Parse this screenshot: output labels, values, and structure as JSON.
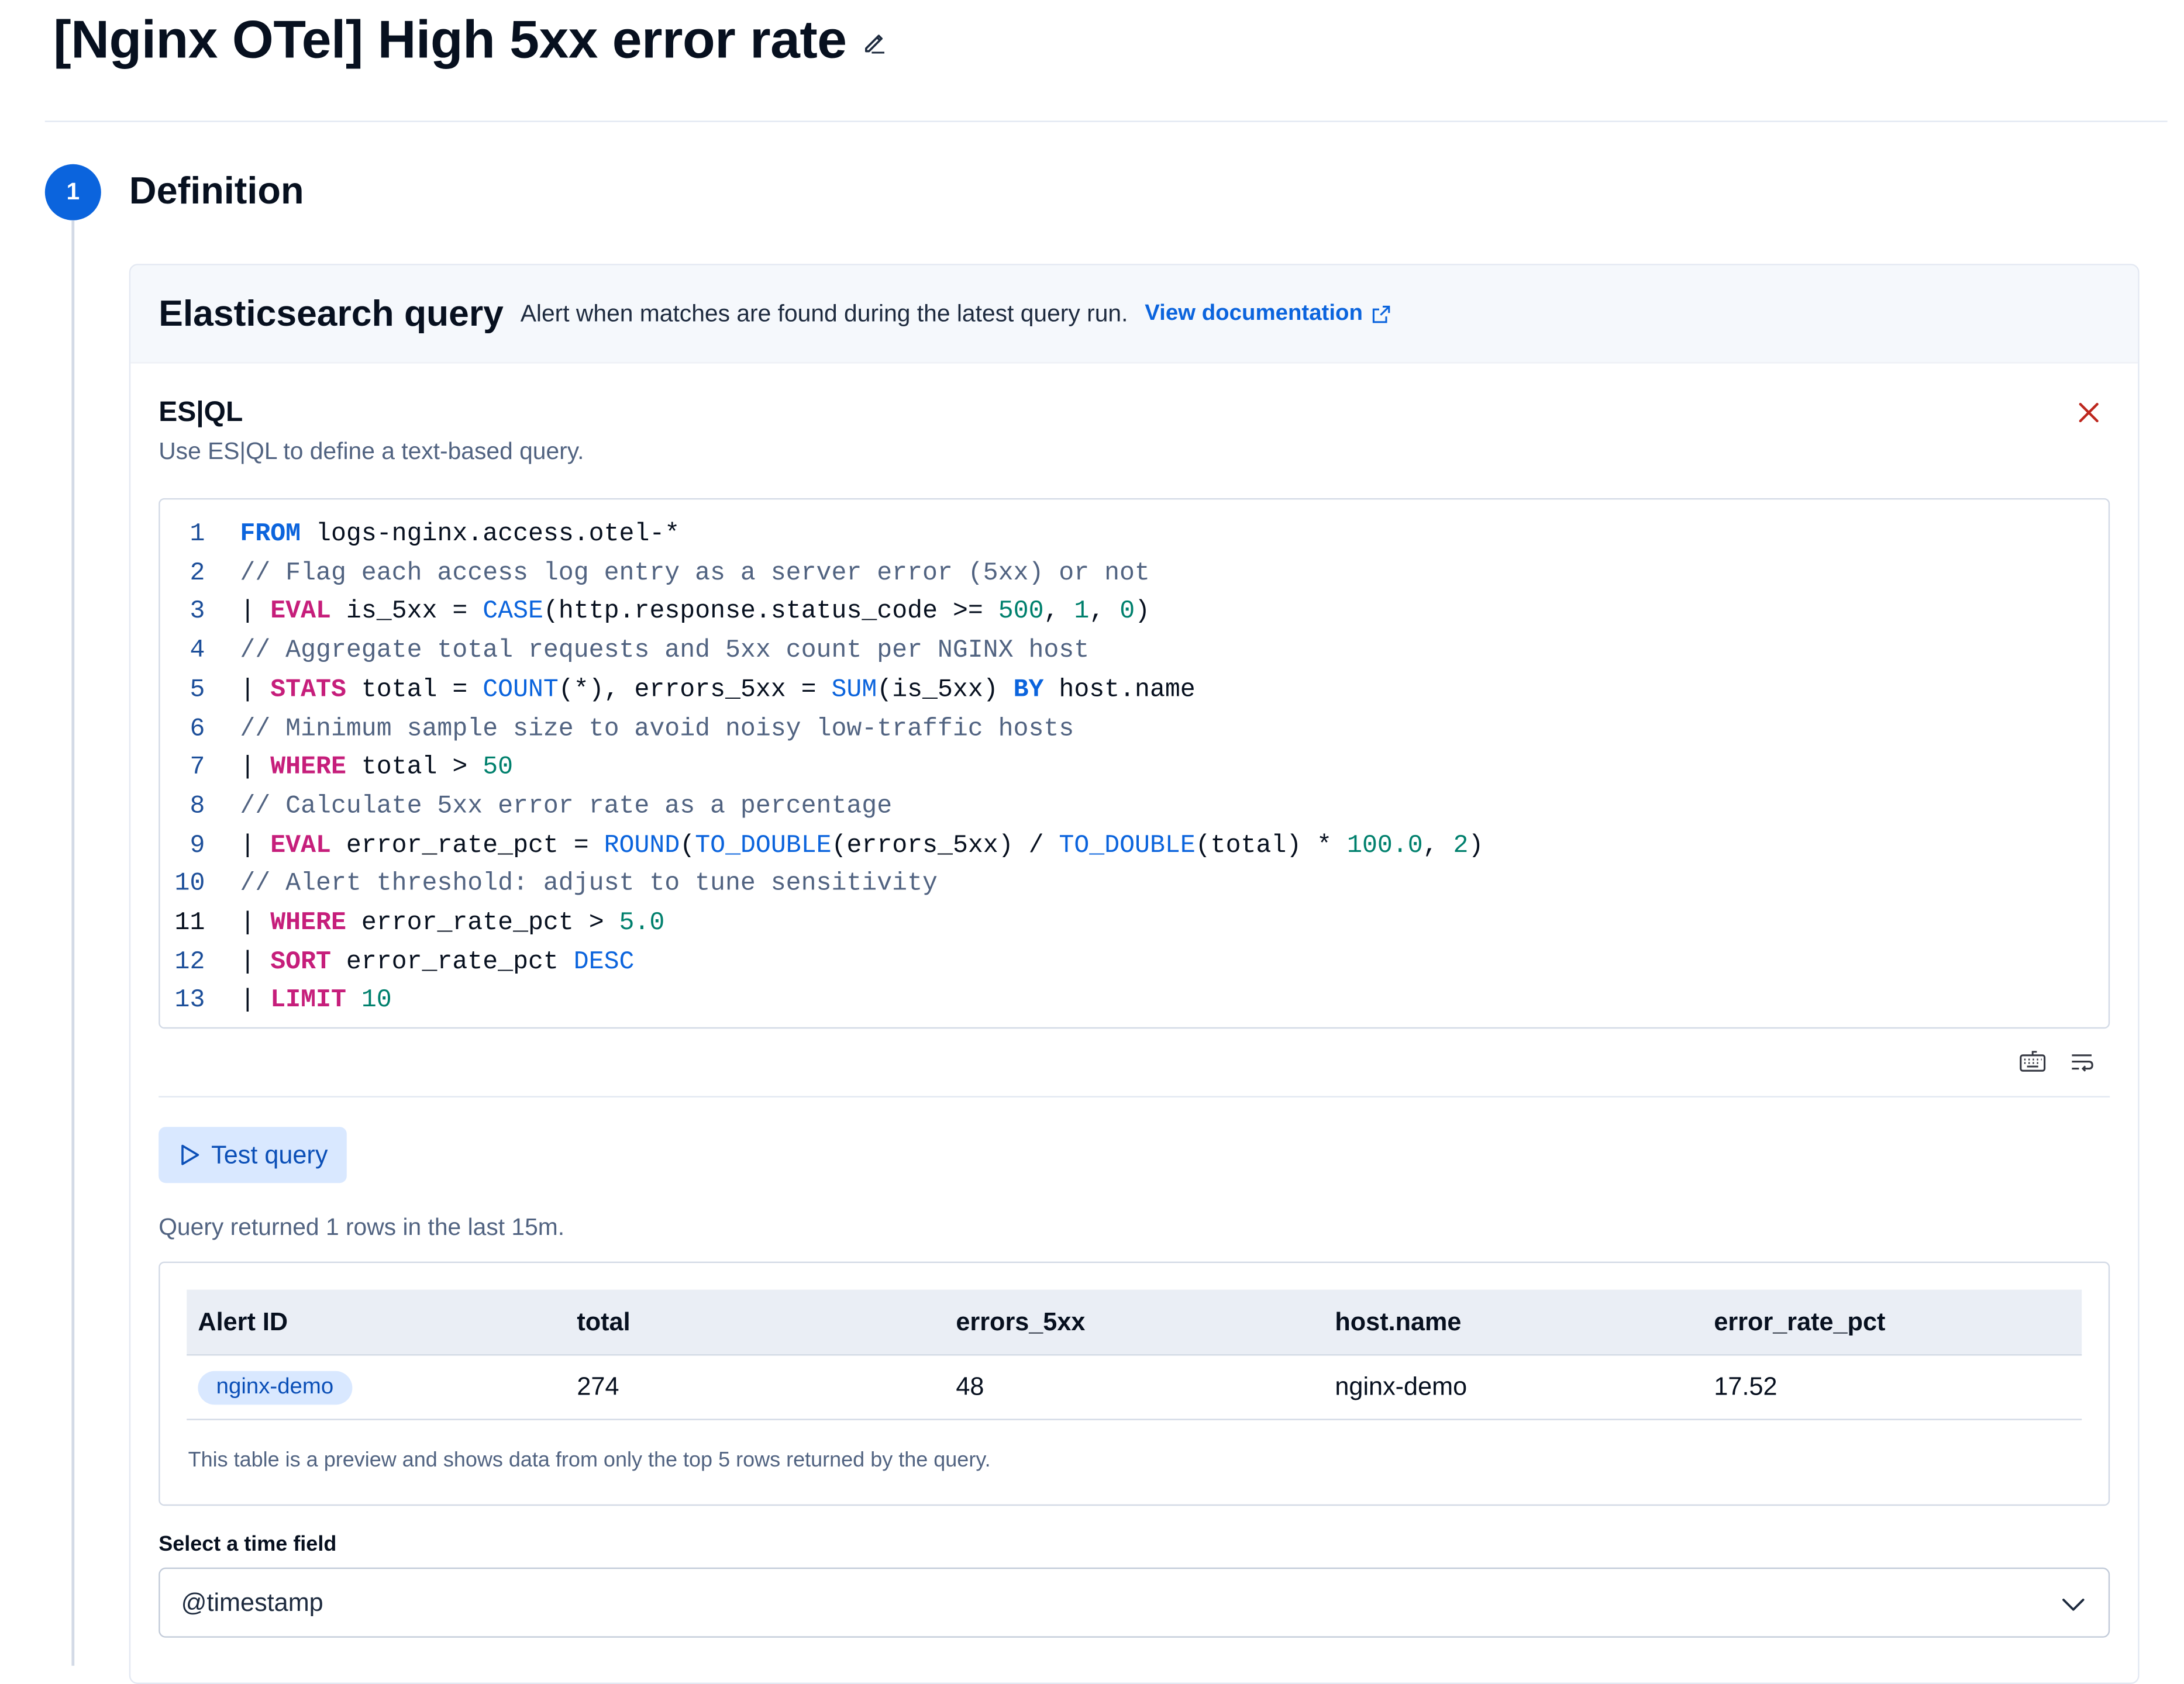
{
  "page": {
    "title": "[Nginx OTel] High 5xx error rate"
  },
  "step": {
    "number": "1",
    "title": "Definition"
  },
  "rule_type": {
    "title": "Elasticsearch query",
    "description": "Alert when matches are found during the latest query run.",
    "doc_link": "View documentation"
  },
  "esql": {
    "title": "ES|QL",
    "description": "Use ES|QL to define a text-based query."
  },
  "editor": {
    "active_line": 11,
    "lines": [
      [
        [
          "kw",
          "FROM"
        ],
        [
          "plain",
          " logs-nginx.access.otel-*"
        ]
      ],
      [
        [
          "cm",
          "// Flag each access log entry as a server error (5xx) or not"
        ]
      ],
      [
        [
          "plain",
          "| "
        ],
        [
          "cmd",
          "EVAL"
        ],
        [
          "plain",
          " is_5xx = "
        ],
        [
          "fn",
          "CASE"
        ],
        [
          "plain",
          "(http.response.status_code >= "
        ],
        [
          "num",
          "500"
        ],
        [
          "plain",
          ", "
        ],
        [
          "num",
          "1"
        ],
        [
          "plain",
          ", "
        ],
        [
          "num",
          "0"
        ],
        [
          "plain",
          ")"
        ]
      ],
      [
        [
          "cm",
          "// Aggregate total requests and 5xx count per NGINX host"
        ]
      ],
      [
        [
          "plain",
          "| "
        ],
        [
          "cmd",
          "STATS"
        ],
        [
          "plain",
          " total = "
        ],
        [
          "fn",
          "COUNT"
        ],
        [
          "plain",
          "(*), errors_5xx = "
        ],
        [
          "fn",
          "SUM"
        ],
        [
          "plain",
          "(is_5xx) "
        ],
        [
          "kw",
          "BY"
        ],
        [
          "plain",
          " host.name"
        ]
      ],
      [
        [
          "cm",
          "// Minimum sample size to avoid noisy low-traffic hosts"
        ]
      ],
      [
        [
          "plain",
          "| "
        ],
        [
          "cmd",
          "WHERE"
        ],
        [
          "plain",
          " total > "
        ],
        [
          "num",
          "50"
        ]
      ],
      [
        [
          "cm",
          "// Calculate 5xx error rate as a percentage"
        ]
      ],
      [
        [
          "plain",
          "| "
        ],
        [
          "cmd",
          "EVAL"
        ],
        [
          "plain",
          " error_rate_pct = "
        ],
        [
          "fn",
          "ROUND"
        ],
        [
          "plain",
          "("
        ],
        [
          "fn",
          "TO_DOUBLE"
        ],
        [
          "plain",
          "(errors_5xx) / "
        ],
        [
          "fn",
          "TO_DOUBLE"
        ],
        [
          "plain",
          "(total) * "
        ],
        [
          "num",
          "100.0"
        ],
        [
          "plain",
          ", "
        ],
        [
          "num",
          "2"
        ],
        [
          "plain",
          ")"
        ]
      ],
      [
        [
          "cm",
          "// Alert threshold: adjust to tune sensitivity"
        ]
      ],
      [
        [
          "plain",
          "| "
        ],
        [
          "cmd",
          "WHERE"
        ],
        [
          "plain",
          " error_rate_pct > "
        ],
        [
          "num",
          "5.0"
        ]
      ],
      [
        [
          "plain",
          "| "
        ],
        [
          "cmd",
          "SORT"
        ],
        [
          "plain",
          " error_rate_pct "
        ],
        [
          "fn",
          "DESC"
        ]
      ],
      [
        [
          "plain",
          "| "
        ],
        [
          "cmd",
          "LIMIT"
        ],
        [
          "plain",
          " "
        ],
        [
          "num",
          "10"
        ]
      ]
    ]
  },
  "toolbar": {
    "keyboard_icon": "keyboard-icon",
    "wrap_icon": "word-wrap-icon"
  },
  "test_button": {
    "label": "Test query",
    "icon": "play-icon"
  },
  "query_result": "Query returned 1 rows in the last 15m.",
  "table": {
    "columns": [
      "Alert ID",
      "total",
      "errors_5xx",
      "host.name",
      "error_rate_pct"
    ],
    "rows": [
      {
        "alert_id": "nginx-demo",
        "total": "274",
        "errors_5xx": "48",
        "host_name": "nginx-demo",
        "error_rate_pct": "17.52"
      }
    ],
    "note": "This table is a preview and shows data from only the top 5 rows returned by the query."
  },
  "time_field": {
    "label": "Select a time field",
    "value": "@timestamp"
  },
  "colors": {
    "accent": "#0b64dd",
    "command": "#c61e7b",
    "number": "#00806d",
    "danger": "#bd271e"
  }
}
